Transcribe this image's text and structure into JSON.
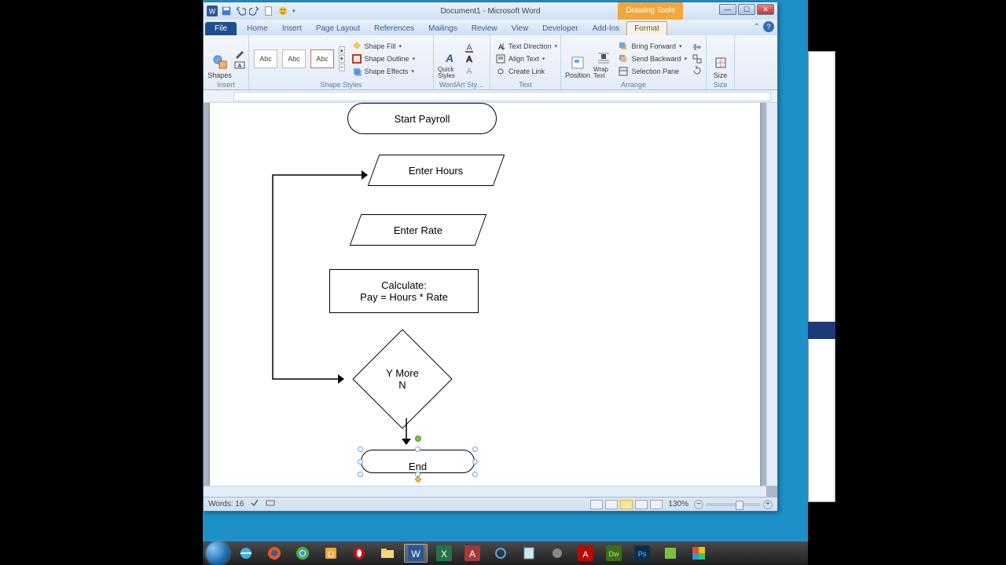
{
  "window": {
    "title": "Document1 - Microsoft Word",
    "context_tools": "Drawing Tools"
  },
  "tabs": {
    "file": "File",
    "home": "Home",
    "insert": "Insert",
    "page_layout": "Page Layout",
    "references": "References",
    "mailings": "Mailings",
    "review": "Review",
    "view": "View",
    "developer": "Developer",
    "addins": "Add-Ins",
    "format": "Format"
  },
  "ribbon": {
    "insert_shapes": {
      "label": "Insert Shapes",
      "shapes_btn": "Shapes"
    },
    "shape_styles": {
      "label": "Shape Styles",
      "sample": "Abc",
      "fill": "Shape Fill",
      "outline": "Shape Outline",
      "effects": "Shape Effects"
    },
    "wordart": {
      "label": "WordArt Sty…",
      "quick": "Quick Styles"
    },
    "text_group": {
      "label": "Text",
      "direction": "Text Direction",
      "align": "Align Text",
      "link": "Create Link"
    },
    "arrange": {
      "label": "Arrange",
      "position": "Position",
      "wrap": "Wrap Text",
      "forward": "Bring Forward",
      "backward": "Send Backward",
      "selection": "Selection Pane"
    },
    "size": {
      "label": "Size",
      "btn": "Size"
    }
  },
  "flowchart": {
    "start": "Start Payroll",
    "hours": "Enter Hours",
    "rate": "Enter Rate",
    "calc1": "Calculate:",
    "calc2": "Pay = Hours * Rate",
    "decision1": "Y   More",
    "decision2": "N",
    "end": "End"
  },
  "status": {
    "words": "Words: 16",
    "zoom": "130%"
  },
  "taskbar": {
    "apps": [
      "start",
      "ie",
      "firefox",
      "chrome",
      "outlook",
      "opera",
      "explorer",
      "word",
      "excel",
      "access",
      "app1",
      "notepad",
      "app2",
      "reader",
      "dreamweaver",
      "photoshop",
      "app3",
      "app4"
    ]
  }
}
